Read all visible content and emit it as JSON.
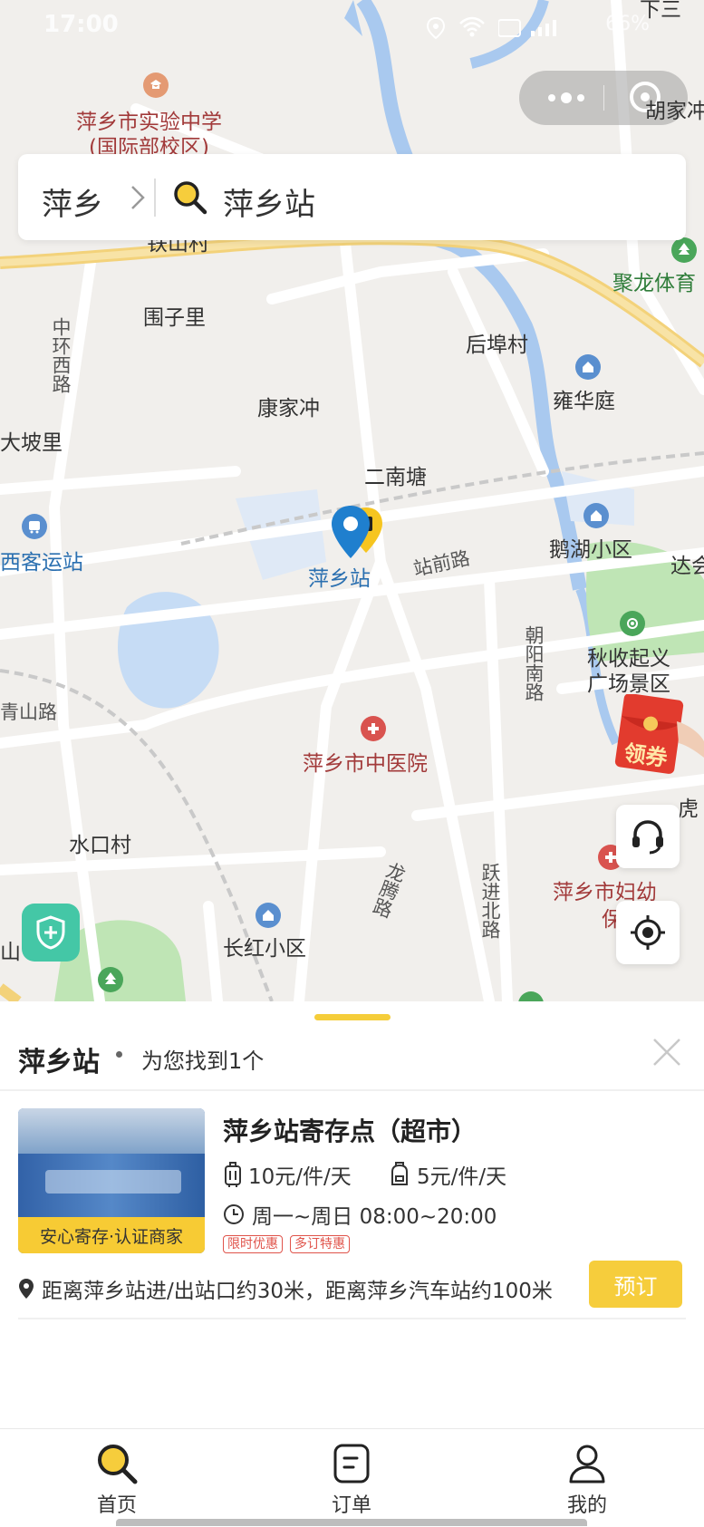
{
  "status_bar": {
    "time": "17:00",
    "battery": "66%"
  },
  "search": {
    "city": "萍乡",
    "query": "萍乡站"
  },
  "map": {
    "labels": {
      "school_1": "萍乡市实验中学",
      "school_2": "(国际部校区)",
      "hujia": "胡家冲",
      "xiasan": "下三",
      "tieshan": "铁山村",
      "weizili": "围子里",
      "zhonghuan": "中环西路",
      "houfucun": "后埠村",
      "julong": "聚龙体育",
      "yonghuating": "雍华庭",
      "kangjiachong": "康家冲",
      "dapoli": "大坡里",
      "ernantang": "二南塘",
      "xikeyunzhan": "西客运站",
      "pingxiangzhan": "萍乡站",
      "zhanqianlu": "站前路",
      "ehuxiaoqu": "鹅湖小区",
      "dahe": "达会",
      "chaoyangnanlu": "朝阳南路",
      "qiushou_1": "秋收起义",
      "qiushou_2": "广场景区",
      "qingshanlu": "青山路",
      "zhongyiyuan": "萍乡市中医院",
      "hukou": "虎",
      "shuikoucun": "水口村",
      "longtenglu": "龙腾路",
      "yuejinbeilu": "跃进北路",
      "fuyou_1": "萍乡市妇幼",
      "fuyou_2": "保健",
      "shan": "山",
      "changhong": "长红小区"
    },
    "coupon_label": "领券"
  },
  "sheet": {
    "title": "萍乡站",
    "found_text": "为您找到1个",
    "store": {
      "name": "萍乡站寄存点（超市）",
      "price_large": "10元/件/天",
      "price_small": "5元/件/天",
      "hours": "周一~周日 08:00~20:00",
      "badges": [
        "限时优惠",
        "多订特惠"
      ],
      "thumb_tag": "安心寄存·认证商家",
      "distance": "距离萍乡站进/出站口约30米，距离萍乡汽车站约100米",
      "book_label": "预订"
    }
  },
  "tabs": [
    {
      "label": "首页",
      "icon": "search-icon"
    },
    {
      "label": "订单",
      "icon": "order-icon"
    },
    {
      "label": "我的",
      "icon": "profile-icon"
    }
  ],
  "colors": {
    "accent": "#f6cd3c",
    "river": "#a9c9ef",
    "park": "#bfe5b5",
    "road_major": "#f3d27a"
  }
}
